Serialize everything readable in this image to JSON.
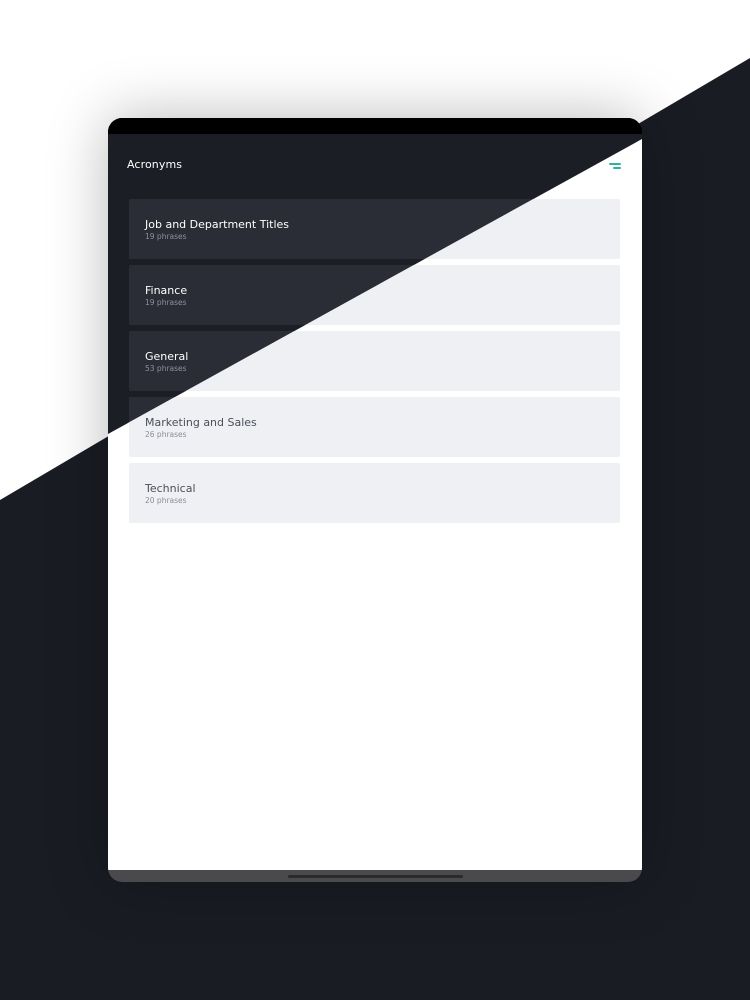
{
  "app": {
    "title": "Acronyms"
  },
  "header": {
    "menu_icon": "menu-icon"
  },
  "categories": [
    {
      "title": "Job and Department Titles",
      "count": "19 phrases"
    },
    {
      "title": "Finance",
      "count": "19 phrases"
    },
    {
      "title": "General",
      "count": "53 phrases"
    },
    {
      "title": "Marketing and Sales",
      "count": "26 phrases"
    },
    {
      "title": "Technical",
      "count": "20 phrases"
    }
  ],
  "colors": {
    "dark_bg": "#1c1e26",
    "dark_card": "#2b2d36",
    "light_card": "#eef0f3",
    "accent": "#2bb3a0"
  }
}
